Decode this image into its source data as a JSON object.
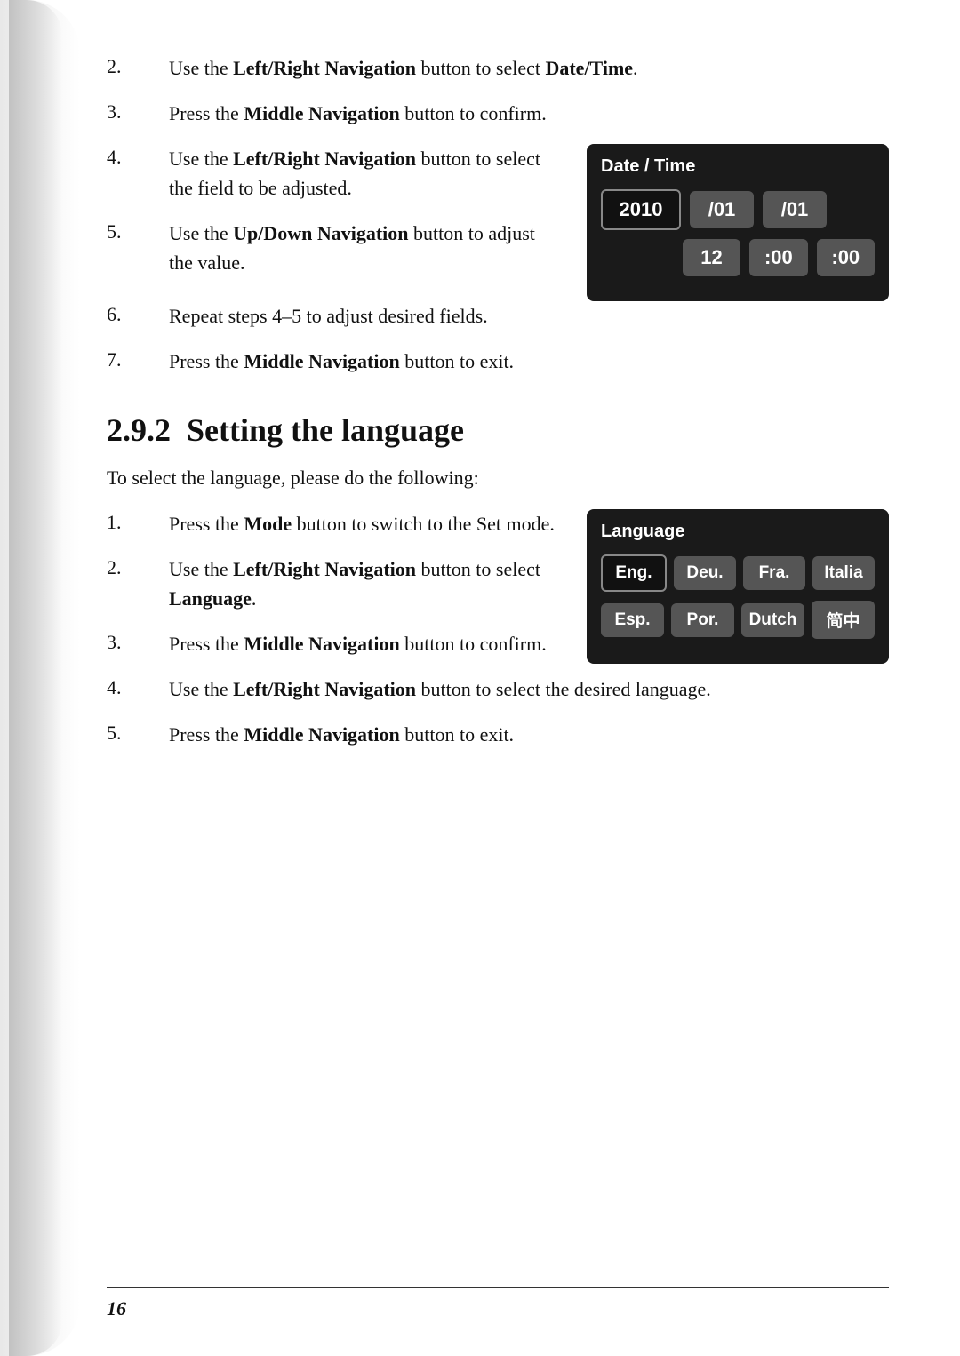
{
  "page": {
    "number": "16"
  },
  "section_2_continued": {
    "items": [
      {
        "num": "2.",
        "text_parts": [
          {
            "text": "Use the ",
            "bold": false
          },
          {
            "text": "Left/Right Navigation",
            "bold": true
          },
          {
            "text": " button to select ",
            "bold": false
          },
          {
            "text": "Date/Time",
            "bold": true
          },
          {
            "text": ".",
            "bold": false
          }
        ]
      },
      {
        "num": "3.",
        "text_parts": [
          {
            "text": "Press the ",
            "bold": false
          },
          {
            "text": "Middle Navigation",
            "bold": true
          },
          {
            "text": " button to confirm.",
            "bold": false
          }
        ]
      }
    ],
    "item4": {
      "num": "4.",
      "text_parts": [
        {
          "text": "Use the ",
          "bold": false
        },
        {
          "text": "Left/Right Navigation",
          "bold": true
        },
        {
          "text": " button to select the field to be adjusted.",
          "bold": false
        }
      ]
    },
    "item5": {
      "num": "5.",
      "text_parts": [
        {
          "text": "Use the ",
          "bold": false
        },
        {
          "text": "Up/Down Navigation",
          "bold": true
        },
        {
          "text": " button to adjust the value.",
          "bold": false
        }
      ]
    },
    "item6": {
      "num": "6.",
      "text_parts": [
        {
          "text": "Repeat steps 4–5 to adjust desired fields.",
          "bold": false
        }
      ]
    },
    "item7": {
      "num": "7.",
      "text_parts": [
        {
          "text": "Press the ",
          "bold": false
        },
        {
          "text": "Middle Navigation",
          "bold": true
        },
        {
          "text": " button to exit.",
          "bold": false
        }
      ]
    }
  },
  "datetime_widget": {
    "title": "Date / Time",
    "row1": [
      "2010",
      "/01",
      "/01"
    ],
    "row2": [
      "12",
      ":00",
      ":00"
    ]
  },
  "section_292": {
    "num": "2.9.2",
    "title": "Setting the language",
    "intro": "To select the language, please do the following:",
    "items": [
      {
        "num": "1.",
        "text_parts": [
          {
            "text": "Press the ",
            "bold": false
          },
          {
            "text": "Mode",
            "bold": true
          },
          {
            "text": " button to switch to the Set mode.",
            "bold": false
          }
        ]
      },
      {
        "num": "2.",
        "text_parts": [
          {
            "text": "Use the ",
            "bold": false
          },
          {
            "text": "Left/Right Navigation",
            "bold": true
          },
          {
            "text": " button to select ",
            "bold": false
          },
          {
            "text": "Language",
            "bold": true
          },
          {
            "text": ".",
            "bold": false
          }
        ]
      },
      {
        "num": "3.",
        "text_parts": [
          {
            "text": "Press the ",
            "bold": false
          },
          {
            "text": "Middle Navigation",
            "bold": true
          },
          {
            "text": " button to confirm.",
            "bold": false
          }
        ]
      },
      {
        "num": "4.",
        "text_parts": [
          {
            "text": "Use the ",
            "bold": false
          },
          {
            "text": "Left/Right Navigation",
            "bold": true
          },
          {
            "text": " button to select the desired language.",
            "bold": false
          }
        ]
      },
      {
        "num": "5.",
        "text_parts": [
          {
            "text": "Press the ",
            "bold": false
          },
          {
            "text": "Middle Navigation",
            "bold": true
          },
          {
            "text": " button to exit.",
            "bold": false
          }
        ]
      }
    ]
  },
  "language_widget": {
    "title": "Language",
    "row1": [
      "Eng.",
      "Deu.",
      "Fra.",
      "Italia"
    ],
    "row2": [
      "Esp.",
      "Por.",
      "Dutch",
      "简中"
    ]
  }
}
